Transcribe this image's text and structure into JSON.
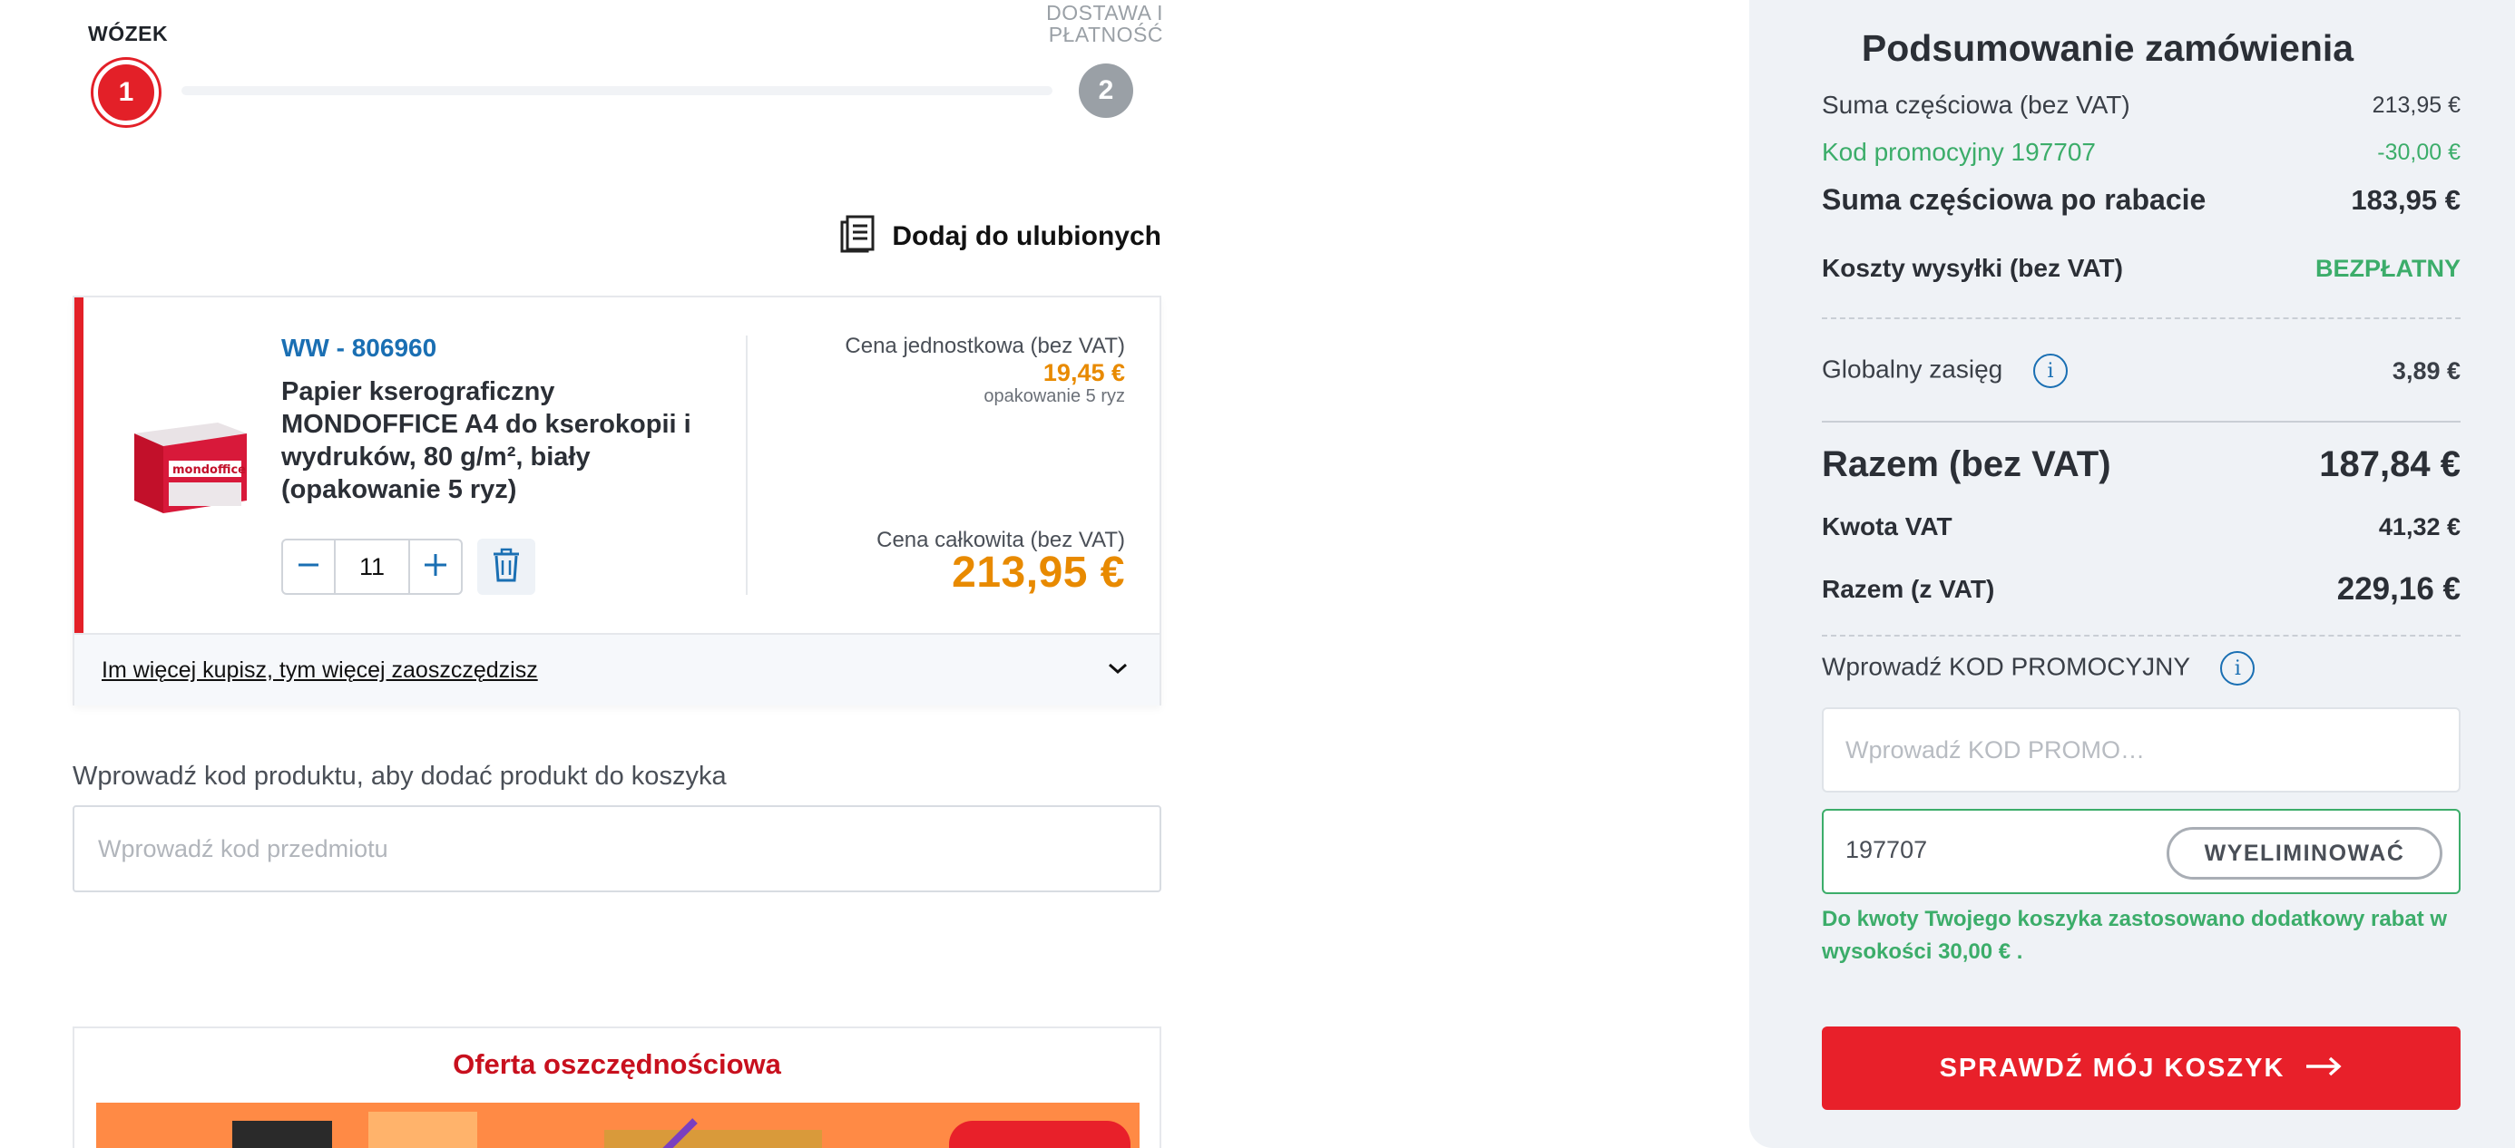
{
  "stepper": {
    "step1": {
      "label": "WÓZEK",
      "number": "1"
    },
    "step2": {
      "label": "DOSTAWA I PŁATNOŚĆ",
      "number": "2"
    }
  },
  "favorites": {
    "label": "Dodaj do ulubionych",
    "icon": "document-list-icon"
  },
  "product": {
    "sku": "WW - 806960",
    "name": "Papier kserograficzny MONDOFFICE A4 do kserokopii i wydruków, 80 g/m², biały (opakowanie 5 ryz)",
    "unit_price_label": "Cena jednostkowa (bez VAT)",
    "unit_price": "19,45 €",
    "unit_pack": "opakowanie 5 ryz",
    "total_price_label": "Cena całkowita (bez VAT)",
    "total_price": "213,95 €",
    "quantity": "11",
    "save_more_label": "Im więcej kupisz, tym więcej zaoszczędzisz"
  },
  "product_code": {
    "label": "Wprowadź kod produktu, aby dodać produkt do koszyka",
    "placeholder": "Wprowadź kod przedmiotu"
  },
  "offer": {
    "title": "Oferta oszczędnościowa"
  },
  "summary": {
    "title": "Podsumowanie zamówienia",
    "subtotal_label": "Suma częściowa (bez VAT)",
    "subtotal_value": "213,95 €",
    "promo_label": "Kod promocyjny 197707",
    "promo_value": "-30,00 €",
    "subtotal_discount_label": "Suma częściowa po rabacie",
    "subtotal_discount_value": "183,95 €",
    "shipping_label": "Koszty wysyłki (bez VAT)",
    "shipping_value": "BEZPŁATNY",
    "global_label": "Globalny zasięg",
    "global_value": "3,89 €",
    "total_net_label": "Razem (bez VAT)",
    "total_net_value": "187,84 €",
    "vat_label": "Kwota VAT",
    "vat_value": "41,32 €",
    "total_gross_label": "Razem (z VAT)",
    "total_gross_value": "229,16 €",
    "promo_code_label": "Wprowadź KOD PROMOCYJNY",
    "promo_code_placeholder": "Wprowadź KOD PROMO…",
    "applied_code": "197707",
    "remove_label": "WYELIMINOWAĆ",
    "applied_message": "Do kwoty Twojego koszyka zastosowano dodatkowy rabat w wysokości 30,00 € .",
    "checkout_label": "SPRAWDŹ MÓJ KOSZYK"
  },
  "colors": {
    "accent_red": "#e32028",
    "price_orange": "#e88a00",
    "success_green": "#3cad6a",
    "link_blue": "#1a6fb3"
  }
}
